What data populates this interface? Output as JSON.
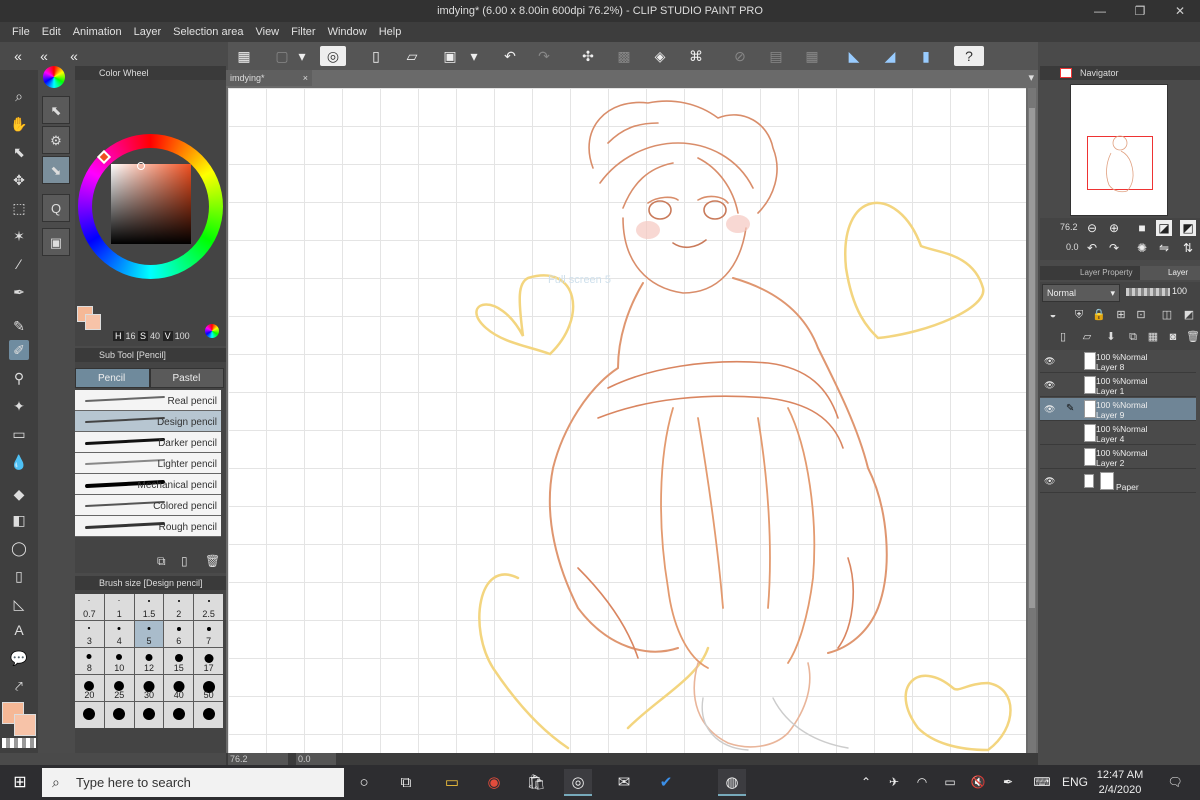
{
  "window": {
    "title": "imdying* (6.00 x 8.00in 600dpi 76.2%) - CLIP STUDIO PAINT PRO",
    "minimize": "—",
    "maximize": "❐",
    "close": "✕"
  },
  "menu": [
    "File",
    "Edit",
    "Animation",
    "Layer",
    "Selection area",
    "View",
    "Filter",
    "Window",
    "Help"
  ],
  "color_panel": {
    "title": "Color Wheel",
    "h_key": "H",
    "h_val": "16",
    "s_key": "S",
    "s_val": "40",
    "v_key": "V",
    "v_val": "100",
    "main_color": "#f6b896",
    "sub_color": "#f7c3a8"
  },
  "subtool_panel": {
    "title": "Sub Tool [Pencil]",
    "tabs": [
      "Pencil",
      "Pastel"
    ],
    "brushes": [
      "Real pencil",
      "Design pencil",
      "Darker pencil",
      "Lighter pencil",
      "Mechanical pencil",
      "Colored pencil",
      "Rough pencil"
    ],
    "selected_brush": "Design pencil"
  },
  "brush_size_panel": {
    "title": "Brush size [Design pencil]",
    "sizes": [
      "0.7",
      "1",
      "1.5",
      "2",
      "2.5",
      "3",
      "4",
      "5",
      "6",
      "7",
      "8",
      "10",
      "12",
      "15",
      "17",
      "20",
      "25",
      "30",
      "40",
      "50",
      "",
      "",
      "",
      "",
      ""
    ],
    "selected_size": "5"
  },
  "canvas": {
    "tab_label": "imdying*",
    "tab_close": "×",
    "zoom_status": "76.2",
    "angle_status": "0.0",
    "watermark_text": "Full screen 5"
  },
  "navigator": {
    "title": "Navigator",
    "zoom": "76.2",
    "rotation": "0.0"
  },
  "layer_panel": {
    "tab_property": "Layer Property",
    "tab_layer": "Layer",
    "blend_mode": "Normal",
    "opacity": "100",
    "layers": [
      {
        "line1": "100 %Normal",
        "line2": "Layer 8"
      },
      {
        "line1": "100 %Normal",
        "line2": "Layer 1"
      },
      {
        "line1": "100 %Normal",
        "line2": "Layer 9"
      },
      {
        "line1": "100 %Normal",
        "line2": "Layer 4"
      },
      {
        "line1": "100 %Normal",
        "line2": "Layer 2"
      },
      {
        "line1": "",
        "line2": "Paper"
      }
    ]
  },
  "taskbar": {
    "search_placeholder": "Type here to search",
    "language": "ENG",
    "time": "12:47 AM",
    "date": "2/4/2020"
  },
  "colors": {
    "sketch_orange": "#e39a6f",
    "sketch_heart": "#f3d57f",
    "selection_blue": "#6f8ca0"
  }
}
